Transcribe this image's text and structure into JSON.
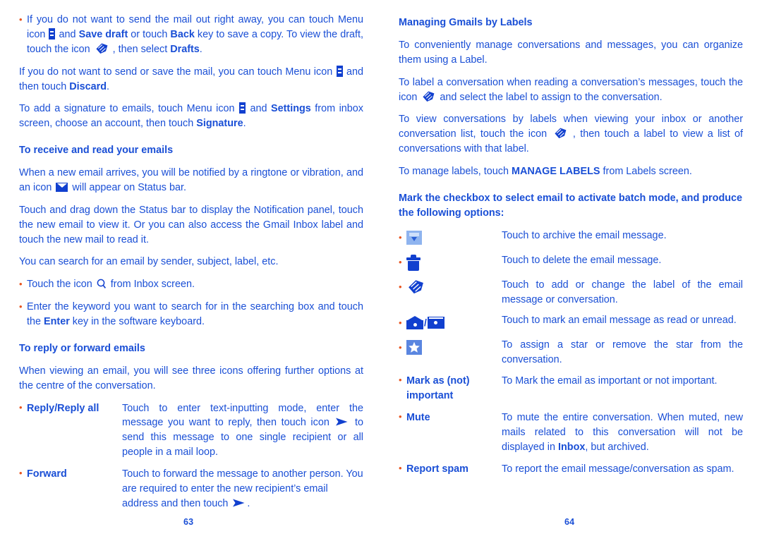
{
  "document": {
    "kind": "user-manual-spread",
    "text_color": "#1a4fd6",
    "bullet_color": "#e8541e",
    "background": "#ffffff"
  },
  "left_page": {
    "folio": "63",
    "blocks": {
      "b1_pre": "If you do not want to send the mail out right away, you can touch Menu icon ",
      "b1_mid1": " and ",
      "b1_bold1": "Save draft",
      "b1_mid2": " or touch ",
      "b1_bold2": "Back",
      "b1_mid3": " key to save a copy. To view the draft, touch the icon ",
      "b1_mid4": " , then select ",
      "b1_bold3": "Drafts",
      "b1_end": ".",
      "p2_pre": "If you do not want to send or save the mail, you can touch Menu icon ",
      "p2_mid": " and then touch ",
      "p2_bold": "Discard",
      "p2_end": ".",
      "p3_pre": "To add a signature to emails, touch Menu icon ",
      "p3_mid1": " and ",
      "p3_bold1": "Settings",
      "p3_mid2": " from inbox screen, choose an account, then touch ",
      "p3_bold2": "Signature",
      "p3_end": ".",
      "h1": "To receive and read your emails",
      "p4_pre": "When a new email arrives, you will be notified by a ringtone or vibration, and an icon ",
      "p4_post": " will appear on Status bar.",
      "p5": "Touch and drag down the Status bar to display the Notification panel, touch the new email to view it. Or you can also access the Gmail Inbox label and touch the new mail to read it.",
      "p6": "You can search for an email by sender, subject, label, etc.",
      "b2_pre": "Touch the icon ",
      "b2_post": " from Inbox screen.",
      "b3_pre": "Enter the keyword you want to search for in the searching box and touch the ",
      "b3_bold": "Enter",
      "b3_post": " key in the software keyboard.",
      "h2": "To reply or forward emails",
      "p7": "When viewing an email, you will see three icons offering further options at the centre of the conversation.",
      "d1_term": "Reply/Reply all",
      "d1_pre": "Touch to enter text-inputting mode, enter the message you want to reply, then touch icon ",
      "d1_post": " to send this message to one single recipient or all people in a mail loop.",
      "d2_term": "Forward",
      "d2_pre": "Touch to forward the message to another person. You are required to enter the new recipient’s email address and then touch ",
      "d2_post": "."
    }
  },
  "right_page": {
    "folio": "64",
    "blocks": {
      "h1": "Managing Gmails by Labels",
      "p1": "To conveniently manage conversations and messages, you can organize them using a Label.",
      "p2_pre": "To label a conversation when reading a conversation’s messages, touch the icon ",
      "p2_post": " and select the label to assign to the conversation.",
      "p3_pre": "To view conversations by labels when viewing your inbox or another conversation list, touch the icon ",
      "p3_post": " , then touch a label to view a list of conversations with that label.",
      "p4_pre": "To manage labels, touch ",
      "p4_bold": "MANAGE LABELS",
      "p4_post": " from Labels screen.",
      "h2": "Mark the checkbox to select email to activate batch mode, and produce the following options:"
    },
    "options": [
      {
        "icon": "archive-icon",
        "term": "",
        "description": "Touch to archive the email message."
      },
      {
        "icon": "trash-icon",
        "term": "",
        "description": "Touch to delete the email message."
      },
      {
        "icon": "label-tag-icon",
        "term": "",
        "description": "Touch to add or change the label of the email message or conversation."
      },
      {
        "icon": "mail-read-unread-icon",
        "term": "",
        "description": "Touch to mark an email message as read or unread."
      },
      {
        "icon": "star-icon",
        "term": "",
        "description": "To assign a star or remove the star from the conversation."
      },
      {
        "icon": "",
        "term": "Mark as (not) important",
        "description": "To Mark the email as important or not important."
      },
      {
        "icon": "",
        "term": "Mute",
        "description_pre": "To mute the entire conversation. When muted, new mails related to this conversation will not be displayed in ",
        "description_bold": "Inbox",
        "description_post": ", but archived."
      },
      {
        "icon": "",
        "term": "Report spam",
        "description": "To report the email message/conversation as spam."
      }
    ]
  }
}
